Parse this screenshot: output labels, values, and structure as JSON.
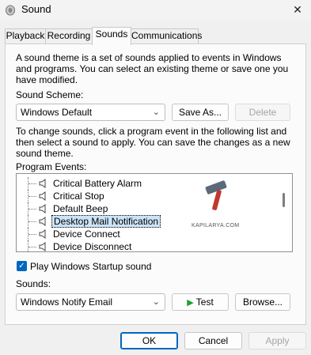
{
  "window": {
    "title": "Sound",
    "close_glyph": "✕"
  },
  "tabs": [
    {
      "label": "Playback"
    },
    {
      "label": "Recording"
    },
    {
      "label": "Sounds"
    },
    {
      "label": "Communications"
    }
  ],
  "sounds_tab": {
    "intro": [
      "A sound theme is a set of sounds applied to events in Windows",
      "and programs.  You can select an existing theme or save one you",
      "have modified."
    ],
    "scheme_label": "Sound Scheme:",
    "scheme_value": "Windows Default",
    "save_as_label": "Save As...",
    "delete_label": "Delete",
    "instructions": [
      "To change sounds, click a program event in the following list and",
      "then select a sound to apply.  You can save the changes as a new",
      "sound theme."
    ],
    "events_label": "Program Events:",
    "events": [
      {
        "label": "Critical Battery Alarm"
      },
      {
        "label": "Critical Stop"
      },
      {
        "label": "Default Beep"
      },
      {
        "label": "Desktop Mail Notification"
      },
      {
        "label": "Device Connect"
      },
      {
        "label": "Device Disconnect"
      }
    ],
    "watermark_text": "KAPILARYA.COM",
    "startup_label": "Play Windows Startup sound",
    "startup_checked": true,
    "sounds_label": "Sounds:",
    "sound_value": "Windows Notify Email",
    "test_label": "Test",
    "browse_label": "Browse..."
  },
  "footer": {
    "ok_label": "OK",
    "cancel_label": "Cancel",
    "apply_label": "Apply"
  }
}
